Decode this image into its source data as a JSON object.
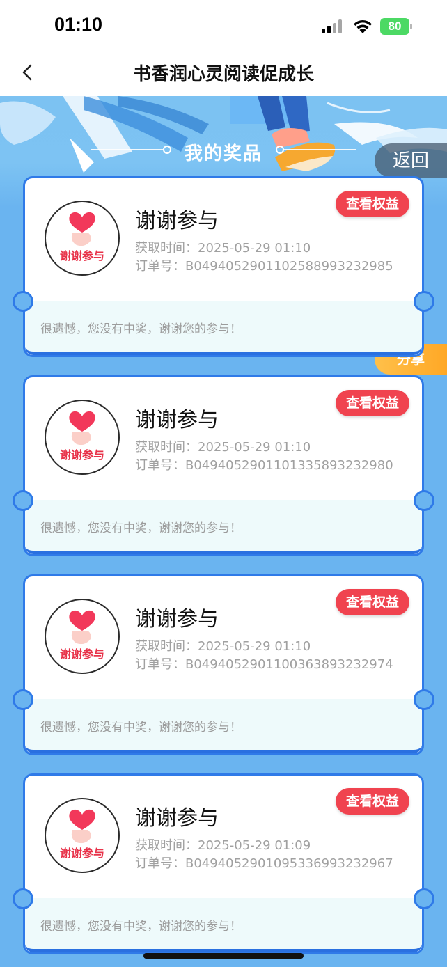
{
  "status": {
    "time": "01:10",
    "battery": "80"
  },
  "nav": {
    "title": "书香润心灵阅读促成长"
  },
  "banner": {
    "title": "我的奖品"
  },
  "buttons": {
    "return_label": "返回",
    "share_label": "分享"
  },
  "colors": {
    "card_border": "#2f7ae8",
    "view_button": "#f0434f",
    "share_button": "#ffb030",
    "background": "#6ab4f0"
  },
  "cards": [
    {
      "prize_name": "谢谢参与",
      "circle_label": "谢谢参与",
      "time": "获取时间：2025-05-29 01:10",
      "order": "订单号：B0494052901102588993232985",
      "view_label": "查看权益",
      "sorry": "很遗憾，您没有中奖，谢谢您的参与！"
    },
    {
      "prize_name": "谢谢参与",
      "circle_label": "谢谢参与",
      "time": "获取时间：2025-05-29 01:10",
      "order": "订单号：B0494052901101335893232980",
      "view_label": "查看权益",
      "sorry": "很遗憾，您没有中奖，谢谢您的参与！"
    },
    {
      "prize_name": "谢谢参与",
      "circle_label": "谢谢参与",
      "time": "获取时间：2025-05-29 01:10",
      "order": "订单号：B0494052901100363893232974",
      "view_label": "查看权益",
      "sorry": "很遗憾，您没有中奖，谢谢您的参与！"
    },
    {
      "prize_name": "谢谢参与",
      "circle_label": "谢谢参与",
      "time": "获取时间：2025-05-29 01:09",
      "order": "订单号：B0494052901095336993232967",
      "view_label": "查看权益",
      "sorry": "很遗憾，您没有中奖，谢谢您的参与！"
    }
  ]
}
